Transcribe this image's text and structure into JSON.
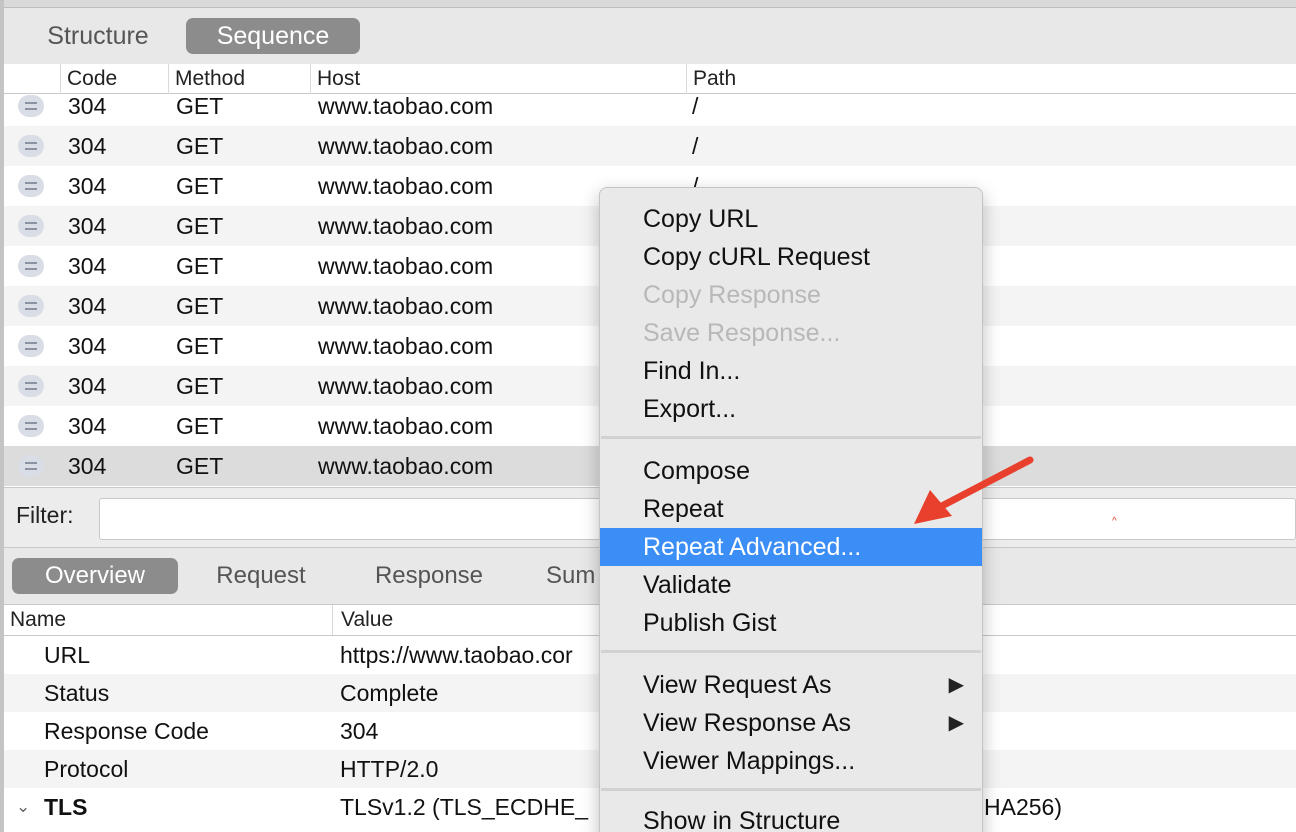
{
  "view_tabs": {
    "structure": "Structure",
    "sequence": "Sequence"
  },
  "columns": {
    "code": "Code",
    "method": "Method",
    "host": "Host",
    "path": "Path"
  },
  "rows": [
    {
      "code": "304",
      "method": "GET",
      "host": "www.taobao.com",
      "path": "/"
    },
    {
      "code": "304",
      "method": "GET",
      "host": "www.taobao.com",
      "path": "/"
    },
    {
      "code": "304",
      "method": "GET",
      "host": "www.taobao.com",
      "path": "/"
    },
    {
      "code": "304",
      "method": "GET",
      "host": "www.taobao.com",
      "path": ""
    },
    {
      "code": "304",
      "method": "GET",
      "host": "www.taobao.com",
      "path": ""
    },
    {
      "code": "304",
      "method": "GET",
      "host": "www.taobao.com",
      "path": ""
    },
    {
      "code": "304",
      "method": "GET",
      "host": "www.taobao.com",
      "path": ""
    },
    {
      "code": "304",
      "method": "GET",
      "host": "www.taobao.com",
      "path": ""
    },
    {
      "code": "304",
      "method": "GET",
      "host": "www.taobao.com",
      "path": ""
    },
    {
      "code": "304",
      "method": "GET",
      "host": "www.taobao.com",
      "path": ""
    }
  ],
  "filter": {
    "label": "Filter:",
    "value": ""
  },
  "detail_tabs": {
    "overview": "Overview",
    "request": "Request",
    "response": "Response",
    "summary": "Sum"
  },
  "overview": {
    "name_header": "Name",
    "value_header": "Value",
    "rows": [
      {
        "name": "URL",
        "value": "https://www.taobao.cor"
      },
      {
        "name": "Status",
        "value": "Complete"
      },
      {
        "name": "Response Code",
        "value": "304"
      },
      {
        "name": "Protocol",
        "value": "HTTP/2.0"
      },
      {
        "name": "TLS",
        "value": "TLSv1.2 (TLS_ECDHE_"
      }
    ],
    "tls_suffix": "HA256)",
    "tls_disclosure": "⌄"
  },
  "context_menu": {
    "items": [
      {
        "label": "Copy URL"
      },
      {
        "label": "Copy cURL Request"
      },
      {
        "label": "Copy Response"
      },
      {
        "label": "Save Response..."
      },
      {
        "label": "Find In..."
      },
      {
        "label": "Export..."
      },
      {
        "label": "Compose"
      },
      {
        "label": "Repeat"
      },
      {
        "label": "Repeat Advanced..."
      },
      {
        "label": "Validate"
      },
      {
        "label": "Publish Gist"
      },
      {
        "label": "View Request As"
      },
      {
        "label": "View Response As"
      },
      {
        "label": "Viewer Mappings..."
      },
      {
        "label": "Show in Structure"
      }
    ],
    "submenu_arrow": "▶"
  },
  "colors": {
    "highlight": "#3a8ef6",
    "annotation_arrow": "#e8402d",
    "active_tab": "#8c8c8c"
  },
  "annotation": {
    "caret": "^"
  }
}
